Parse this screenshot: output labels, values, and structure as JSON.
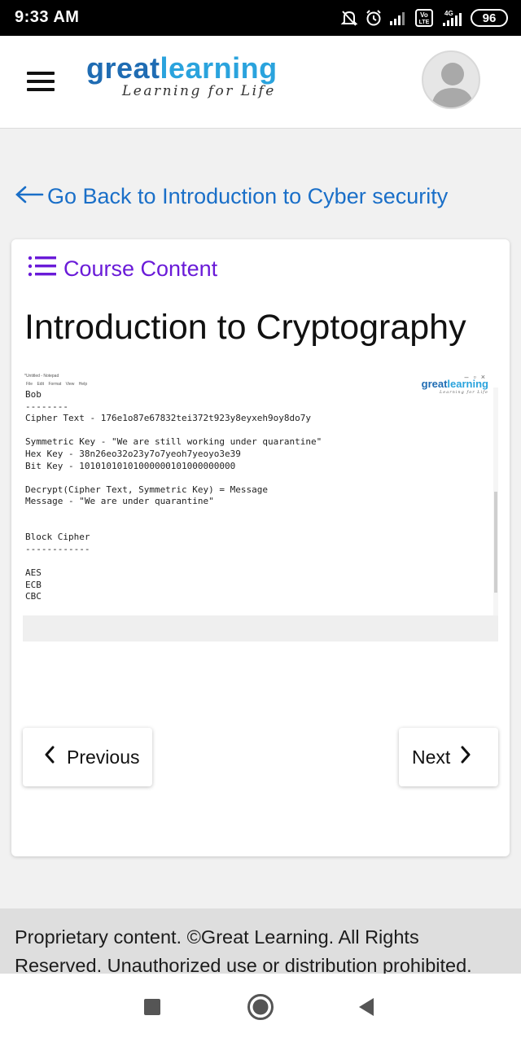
{
  "status_bar": {
    "time": "9:33 AM",
    "battery": "96",
    "network": "4G",
    "volte": "Vo LTE"
  },
  "header": {
    "logo_part1": "great",
    "logo_part2": "learning",
    "tagline": "Learning for Life"
  },
  "back_link": {
    "label": "Go Back to Introduction to Cyber security"
  },
  "course_content": {
    "label": "Course Content"
  },
  "lesson": {
    "title": "Introduction to Cryptography"
  },
  "video": {
    "window_title": "*Untitled - Notepad",
    "menu": "File Edit Format View Help",
    "watermark_part1": "great",
    "watermark_part2": "learning",
    "watermark_tagline": "Learning for Life",
    "notepad_text": "Bob\n--------\nCipher Text - 176e1o87e67832tei372t923y8eyxeh9oy8do7y\n\nSymmetric Key - \"We are still working under quarantine\"\nHex Key - 38n26eo32o23y7o7yeoh7yeoyo3e39\nBit Key - 10101010101000000101000000000\n\nDecrypt(Cipher Text, Symmetric Key) = Message\nMessage - \"We are under quarantine\"\n\n\nBlock Cipher\n------------\n\nAES\nECB\nCBC"
  },
  "navigation": {
    "previous_label": "Previous",
    "next_label": "Next"
  },
  "footer": {
    "text": "Proprietary content. ©Great Learning. All Rights Reserved. Unauthorized use or distribution prohibited."
  },
  "colors": {
    "brand_dark": "#1f6cb3",
    "brand_light": "#2aa3dd",
    "link_blue": "#1a6fc8",
    "purple": "#6a1bd8"
  }
}
